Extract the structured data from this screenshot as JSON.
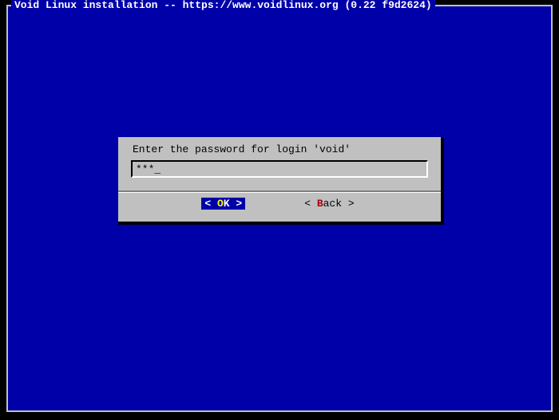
{
  "header": {
    "title": "Void Linux installation -- https://www.voidlinux.org (0.22 f9d2624)"
  },
  "dialog": {
    "prompt": "Enter the password for login 'void'",
    "input_value": "***",
    "cursor": "_"
  },
  "buttons": {
    "ok": {
      "open": "<",
      "label_pre": " ",
      "hotkey": "O",
      "label_post": "K ",
      "close": ">"
    },
    "back": {
      "open": "<",
      "label_pre": " ",
      "hotkey": "B",
      "label_post": "ack ",
      "close": ">"
    }
  }
}
